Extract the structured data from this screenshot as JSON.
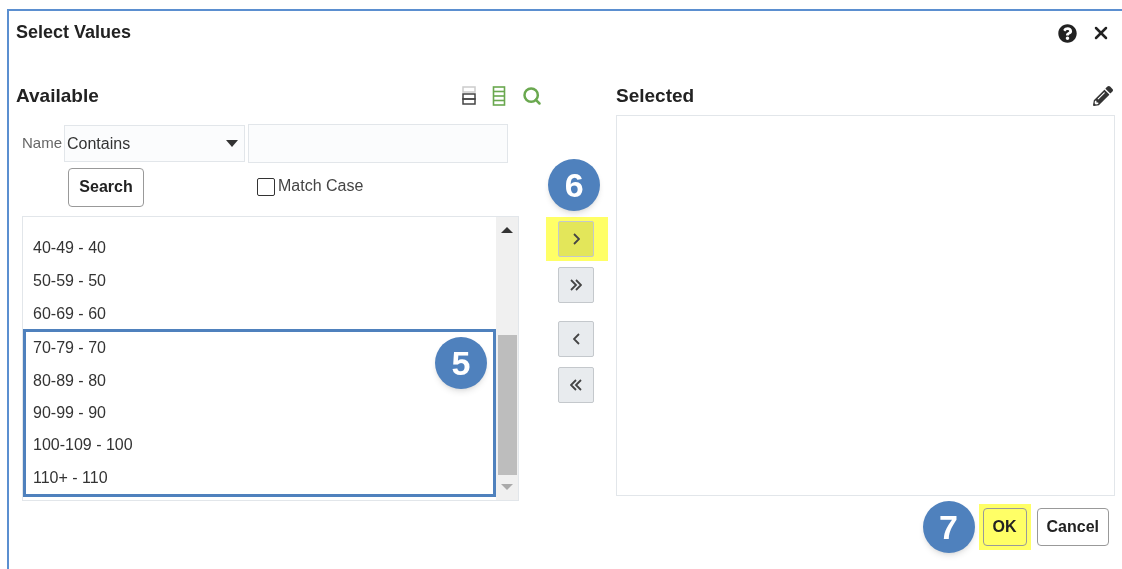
{
  "dialog": {
    "title": "Select Values"
  },
  "available": {
    "heading": "Available",
    "filter": {
      "label": "Name",
      "operator": "Contains"
    },
    "search_button": "Search",
    "match_case": {
      "label": "Match Case",
      "checked": false
    },
    "items": [
      "40-49 - 40",
      "50-59 - 50",
      "60-69 - 60"
    ],
    "outlined_group": {
      "callout": "5",
      "items": [
        "70-79 - 70",
        "80-89 - 80",
        "90-99 - 90",
        "100-109 - 100",
        "110+ - 110"
      ]
    }
  },
  "transfer_buttons": [
    {
      "kind": "move-right",
      "highlighted": true,
      "callout": "6"
    },
    {
      "kind": "move-all-right",
      "highlighted": false
    },
    {
      "kind": "move-left",
      "highlighted": false
    },
    {
      "kind": "move-all-left",
      "highlighted": false
    }
  ],
  "selected": {
    "heading": "Selected"
  },
  "footer_buttons": [
    {
      "label": "OK",
      "highlighted": true,
      "callout": "7"
    },
    {
      "label": "Cancel",
      "highlighted": false
    }
  ]
}
